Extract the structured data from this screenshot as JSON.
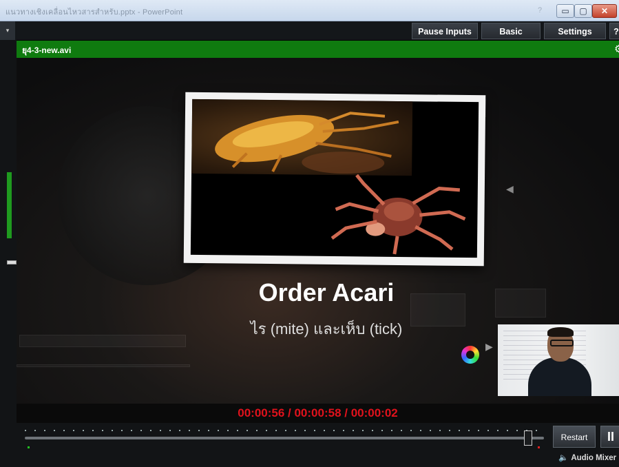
{
  "window": {
    "title": "แนวทางเชิงเคลื่อนไหวสารสำหรับ.pptx - PowerPoint",
    "help_glyph": "?",
    "min_glyph": "▭",
    "max_glyph": "▢",
    "close_glyph": "✕"
  },
  "toolbar": {
    "dropdown_glyph": "▾",
    "pause_inputs": "Pause Inputs",
    "basic": "Basic",
    "settings": "Settings",
    "help": "?"
  },
  "input": {
    "filename": "ยุ4-3-new.avi"
  },
  "preview": {
    "title": "Order Acari",
    "subtitle": "ไร (mite) และเห็บ (tick)"
  },
  "playback": {
    "timecode": "00:00:56  /  00:00:58  /  00:00:02",
    "restart_label": "Restart",
    "pause_glyph": "II",
    "audio_label": "Audio Mixer",
    "audio_icon": "🔈",
    "position_fraction": 0.97
  },
  "colors": {
    "accent_green": "#0f7b0f",
    "timecode_red": "#e0121c"
  }
}
